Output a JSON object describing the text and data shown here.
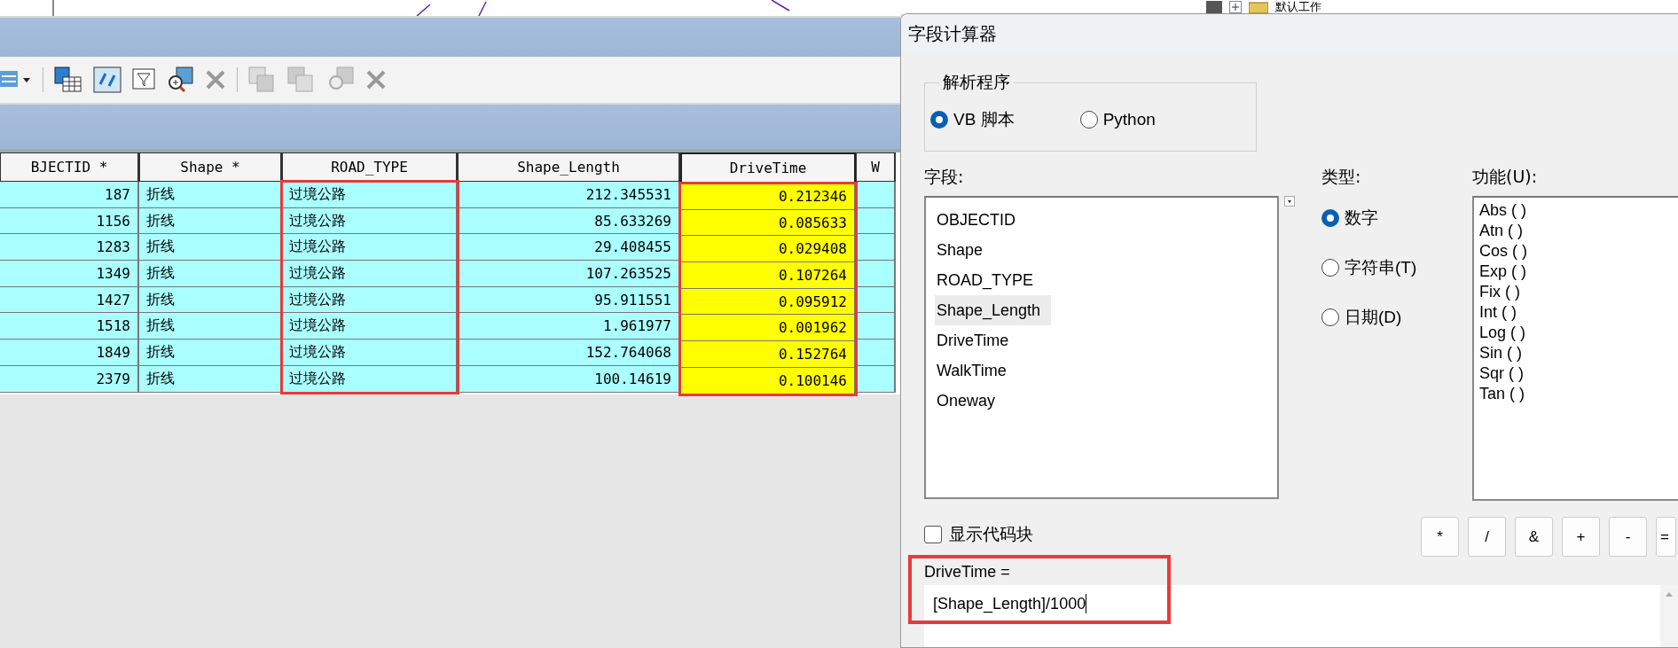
{
  "top_strip": {
    "workspace_label": "默认工作"
  },
  "table": {
    "columns": [
      {
        "label": "BJECTID *",
        "kind": "number",
        "selected": false,
        "highlighted": false
      },
      {
        "label": "Shape *",
        "kind": "text",
        "selected": false,
        "highlighted": false
      },
      {
        "label": "ROAD_TYPE",
        "kind": "text",
        "selected": false,
        "highlighted": true
      },
      {
        "label": "Shape_Length",
        "kind": "number",
        "selected": false,
        "highlighted": false
      },
      {
        "label": "DriveTime",
        "kind": "number",
        "selected": true,
        "highlighted": true
      },
      {
        "label": "W",
        "selected": false,
        "highlighted": false
      }
    ],
    "rows": [
      [
        "187",
        "折线",
        "过境公路",
        "212.345531",
        "0.212346"
      ],
      [
        "1156",
        "折线",
        "过境公路",
        "85.633269",
        "0.085633"
      ],
      [
        "1283",
        "折线",
        "过境公路",
        "29.408455",
        "0.029408"
      ],
      [
        "1349",
        "折线",
        "过境公路",
        "107.263525",
        "0.107264"
      ],
      [
        "1427",
        "折线",
        "过境公路",
        "95.911551",
        "0.095912"
      ],
      [
        "1518",
        "折线",
        "过境公路",
        "1.961977",
        "0.001962"
      ],
      [
        "1849",
        "折线",
        "过境公路",
        "152.764068",
        "0.152764"
      ],
      [
        "2379",
        "折线",
        "过境公路",
        "100.14619",
        "0.100146"
      ]
    ]
  },
  "dialog": {
    "title": "字段计算器",
    "parser": {
      "label": "解析程序",
      "options": [
        {
          "label": "VB 脚本",
          "selected": true
        },
        {
          "label": "Python",
          "selected": false
        }
      ]
    },
    "fields": {
      "label": "字段:",
      "items": [
        {
          "label": "OBJECTID",
          "selected": false
        },
        {
          "label": "Shape",
          "selected": false
        },
        {
          "label": "ROAD_TYPE",
          "selected": false
        },
        {
          "label": "Shape_Length",
          "selected": true
        },
        {
          "label": "DriveTime",
          "selected": false
        },
        {
          "label": "WalkTime",
          "selected": false
        },
        {
          "label": "Oneway",
          "selected": false
        }
      ]
    },
    "type": {
      "label": "类型:",
      "options": [
        {
          "label": "数字",
          "selected": true
        },
        {
          "label": "字符串(T)",
          "selected": false
        },
        {
          "label": "日期(D)",
          "selected": false
        }
      ]
    },
    "functions": {
      "label": "功能(U):",
      "items": [
        "Abs ( )",
        "Atn ( )",
        "Cos ( )",
        "Exp ( )",
        "Fix ( )",
        "Int ( )",
        "Log ( )",
        "Sin ( )",
        "Sqr ( )",
        "Tan ( )"
      ]
    },
    "show_code_block": {
      "label": "显示代码块",
      "checked": false
    },
    "operators": [
      "*",
      "/",
      "&",
      "+",
      "-",
      "="
    ],
    "expression": {
      "label": "DriveTime =",
      "value": "[Shape_Length]/1000",
      "highlighted": true
    }
  }
}
